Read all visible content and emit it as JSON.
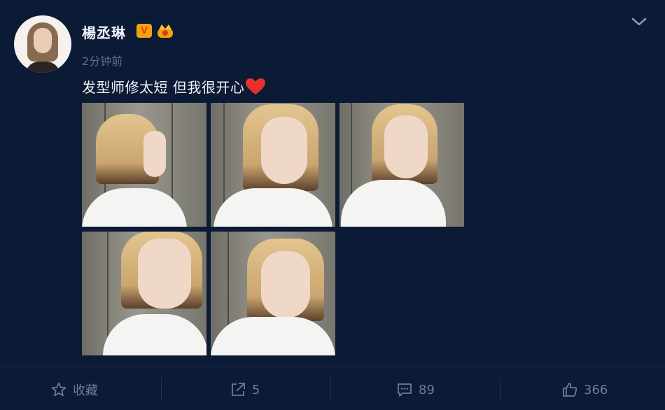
{
  "user": {
    "name": "楊丞琳",
    "verified_badge": "V"
  },
  "post": {
    "time": "2分钟前",
    "text": "发型师修太短 但我很开心",
    "photo_count": 5
  },
  "actions": {
    "favorite_label": "收藏",
    "repost_count": "5",
    "comment_count": "89",
    "like_count": "366"
  },
  "icons": [
    "chevron-down-icon",
    "verified-v-icon",
    "crown-icon",
    "heart-icon",
    "star-icon",
    "share-icon",
    "comment-icon",
    "thumbs-up-icon"
  ],
  "colors": {
    "background": "#0b1a35",
    "badge": "#f2a20c",
    "heart": "#e8302b",
    "muted": "#6d7c97"
  }
}
